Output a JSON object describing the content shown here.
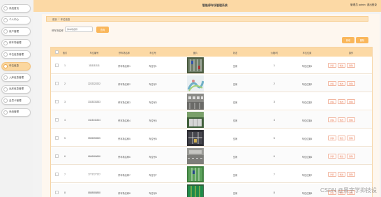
{
  "sidebar": {
    "items": [
      {
        "label": "系统首页",
        "active": false
      },
      {
        "label": "个人中心",
        "active": false
      },
      {
        "label": "用户管理",
        "active": false
      },
      {
        "label": "停车场管理",
        "active": false
      },
      {
        "label": "车位信息管理",
        "active": false
      },
      {
        "label": "车位信息",
        "active": true
      },
      {
        "label": "入库信息管理",
        "active": false
      },
      {
        "label": "出库信息管理",
        "active": false
      },
      {
        "label": "会员卡管理",
        "active": false
      },
      {
        "label": "系统管理",
        "active": false
      }
    ]
  },
  "header": {
    "title": "智能停车场管理系统",
    "user": "管理员 admin",
    "logout": "退出登录"
  },
  "breadcrumb": {
    "home": "首页",
    "separator": "/",
    "current": "车位信息"
  },
  "search": {
    "label": "停车场名称",
    "placeholder": "停车场名称",
    "button": "查询"
  },
  "actions": {
    "add": "新增",
    "delete": "删除"
  },
  "table": {
    "headers": [
      "索引",
      "车位编号",
      "停车场名称",
      "车位号",
      "图片",
      "状态",
      "价格/时",
      "车位位置",
      "操作"
    ],
    "rows": [
      {
        "index": "1",
        "code": "1111111111",
        "lot": "停车场名称1",
        "no": "车位号1",
        "status": "空闲",
        "price": "1",
        "location": "车位位置1"
      },
      {
        "index": "2",
        "code": "2222222222",
        "lot": "停车场名称2",
        "no": "车位号2",
        "status": "空闲",
        "price": "2",
        "location": "车位位置2"
      },
      {
        "index": "3",
        "code": "3333333333",
        "lot": "停车场名称3",
        "no": "车位号3",
        "status": "空闲",
        "price": "3",
        "location": "车位位置3"
      },
      {
        "index": "4",
        "code": "4444444444",
        "lot": "停车场名称4",
        "no": "车位号4",
        "status": "空闲",
        "price": "4",
        "location": "车位位置4"
      },
      {
        "index": "5",
        "code": "5555555555",
        "lot": "停车场名称5",
        "no": "车位号5",
        "status": "空闲",
        "price": "5",
        "location": "车位位置5"
      },
      {
        "index": "6",
        "code": "6666666666",
        "lot": "停车场名称6",
        "no": "车位号6",
        "status": "空闲",
        "price": "6",
        "location": "车位位置6"
      },
      {
        "index": "7",
        "code": "7777777777",
        "lot": "停车场名称7",
        "no": "车位号7",
        "status": "空闲",
        "price": "7",
        "location": "车位位置7"
      },
      {
        "index": "8",
        "code": "8888888888",
        "lot": "停车场名称8",
        "no": "车位号8",
        "status": "空闲",
        "price": "8",
        "location": "车位位置8"
      }
    ],
    "row_actions": [
      "详情",
      "修改",
      "删除"
    ]
  },
  "watermark": "CSDN @黑字学抑技设",
  "colors": {
    "accent": "#fab75b",
    "header_bg": "#fcd9a5",
    "active_nav": "#fbd79f",
    "op_text": "#e8805e"
  }
}
